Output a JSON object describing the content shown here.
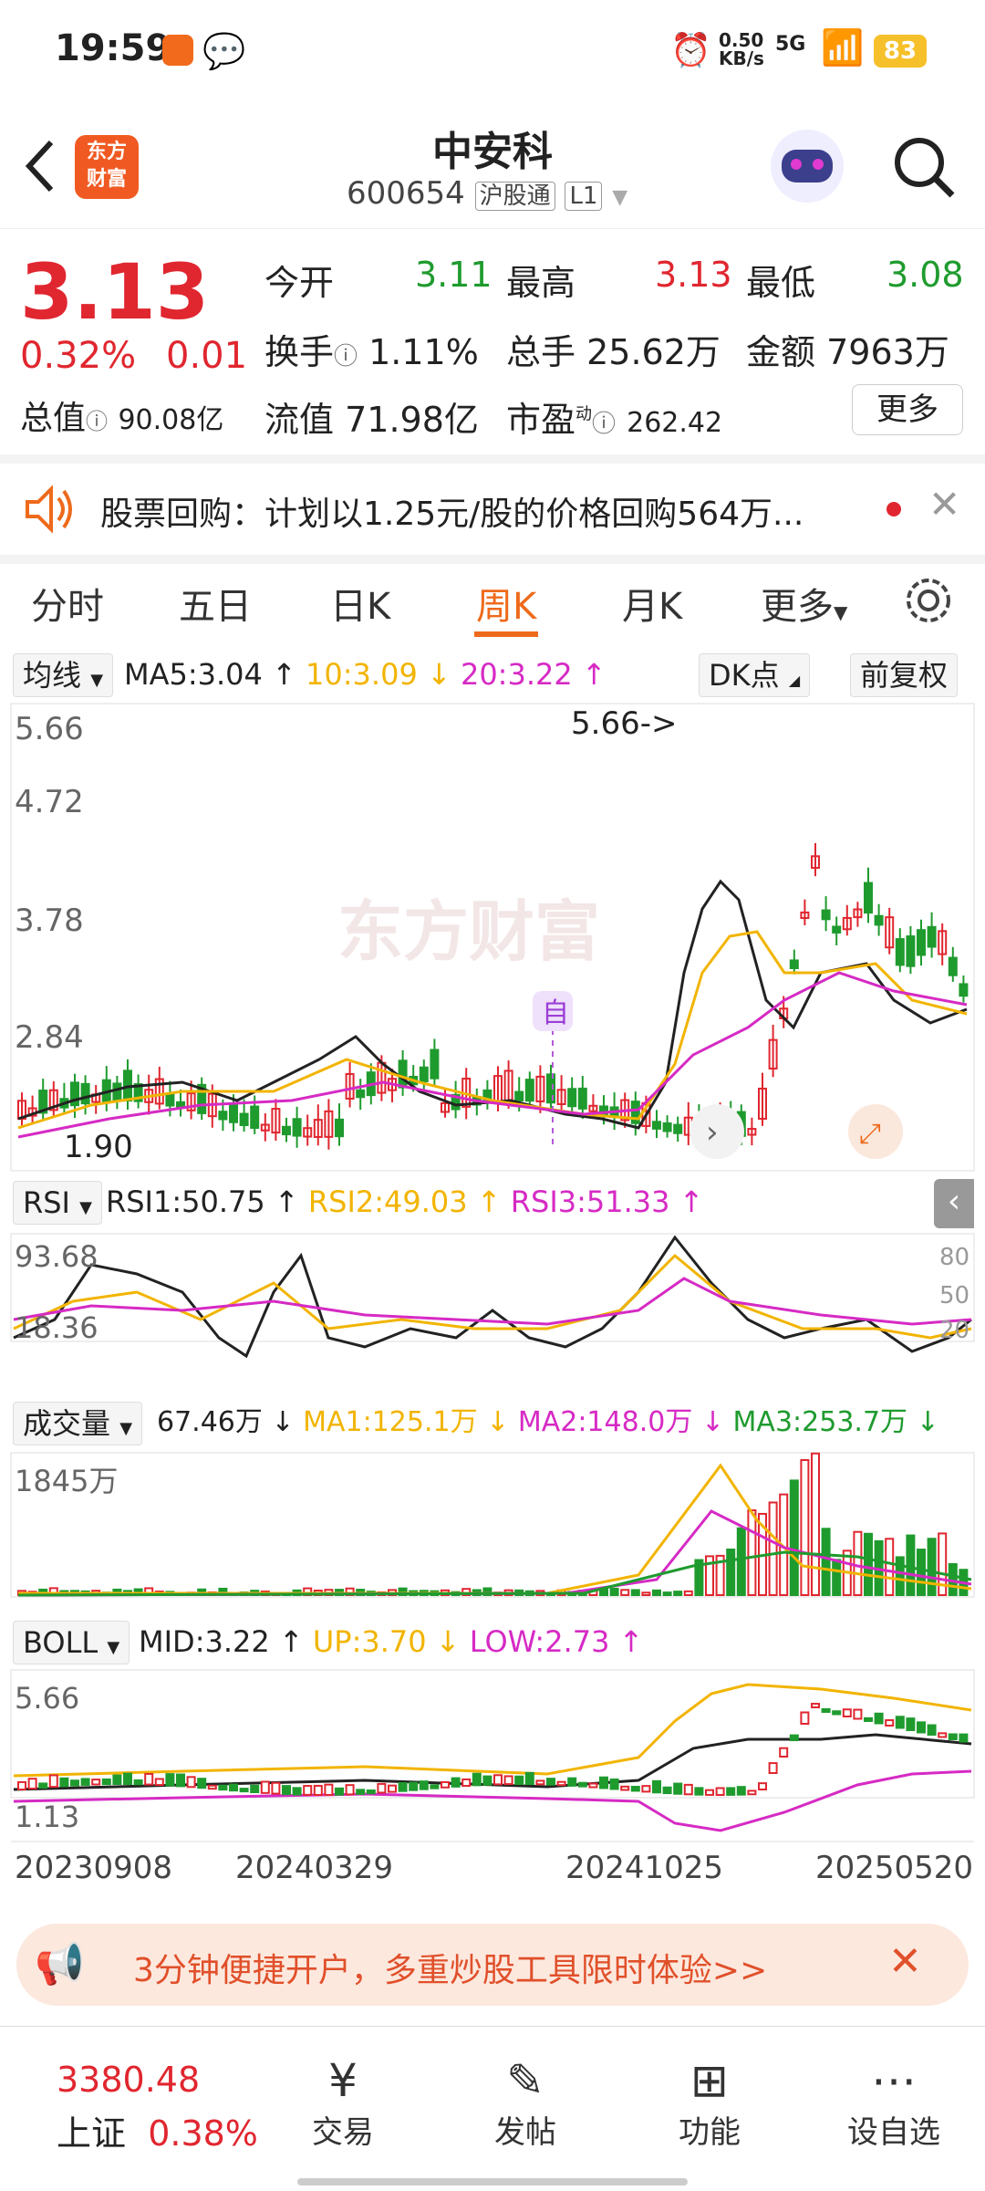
{
  "status": {
    "time": "19:59",
    "net_speed": "0.50",
    "net_unit": "KB/s",
    "signal": "5G",
    "battery": "83"
  },
  "header": {
    "stock_name": "中安科",
    "code": "600654",
    "tag1": "沪股通",
    "tag2": "L1",
    "logo_text": "东方\n财富"
  },
  "quote": {
    "price": "3.13",
    "change_pct": "0.32%",
    "change": "0.01",
    "total_value_label": "总值",
    "total_value": "90.08亿",
    "open_label": "今开",
    "open": "3.11",
    "high_label": "最高",
    "high": "3.13",
    "low_label": "最低",
    "low": "3.08",
    "turnover_label": "换手",
    "turnover": "1.11%",
    "volume_label": "总手",
    "volume": "25.62万",
    "amount_label": "金额",
    "amount": "7963万",
    "float_label": "流值",
    "float_value": "71.98亿",
    "pe_label": "市盈",
    "pe_sup": "动",
    "pe": "262.42",
    "more_label": "更多"
  },
  "notice": {
    "text": "股票回购：计划以1.25元/股的价格回购564万..."
  },
  "tabs": [
    "分时",
    "五日",
    "日K",
    "周K",
    "月K",
    "更多"
  ],
  "active_tab": "周K",
  "ma_row": {
    "selector": "均线",
    "ma5": "MA5:3.04 ↑",
    "ma10": "10:3.09 ↓",
    "ma20": "20:3.22 ↑",
    "dk": "DK点",
    "fq": "前复权"
  },
  "kline": {
    "y_labels": [
      "5.66",
      "4.72",
      "3.78",
      "2.84"
    ],
    "low_label": "1.90",
    "high_note": "5.66->",
    "auto_badge": "自"
  },
  "rsi": {
    "selector": "RSI",
    "rsi1": "RSI1:50.75 ↑",
    "rsi2": "RSI2:49.03 ↑",
    "rsi3": "RSI3:51.33 ↑",
    "top": "93.68",
    "bottom": "18.36",
    "r80": "80",
    "r50": "50",
    "r20": "20"
  },
  "vol": {
    "selector": "成交量",
    "value": "67.46万 ↓",
    "ma1": "MA1:125.1万 ↓",
    "ma2": "MA2:148.0万 ↓",
    "ma3": "MA3:253.7万 ↓",
    "top": "1845万"
  },
  "boll": {
    "selector": "BOLL",
    "mid": "MID:3.22 ↑",
    "up": "UP:3.70 ↓",
    "low": "LOW:2.73 ↑",
    "top": "5.66",
    "bottom": "1.13"
  },
  "dates": [
    "20230908",
    "20240329",
    "20241025",
    "20250520"
  ],
  "banner": {
    "text": "3分钟便捷开户，多重炒股工具限时体验>>"
  },
  "bottom": {
    "index_value": "3380.48",
    "index_name": "上证",
    "index_change": "0.38%",
    "items": [
      "交易",
      "发帖",
      "功能",
      "设自选"
    ]
  },
  "colors": {
    "red": "#e0262f",
    "green": "#1f9b2e",
    "orange": "#ee6a1b",
    "yellow": "#f2b400",
    "magenta": "#d62ac4"
  }
}
